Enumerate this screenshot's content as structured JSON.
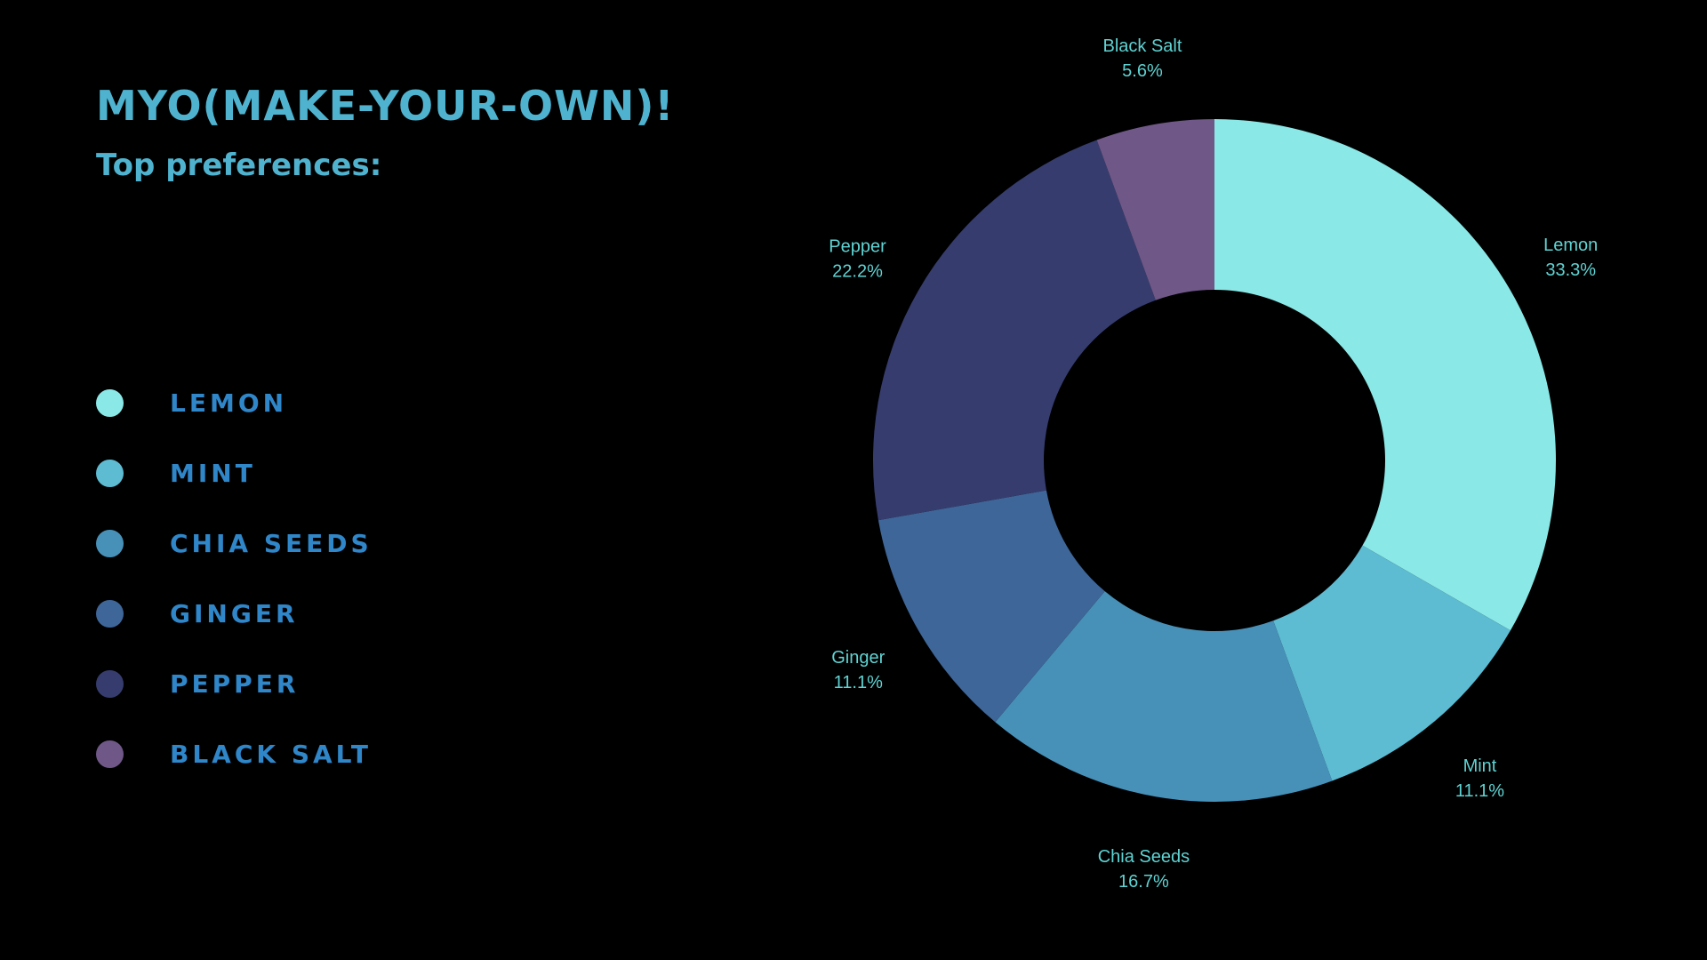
{
  "title": "MYO(MAKE-YOUR-OWN)!",
  "subtitle": "Top preferences:",
  "chart_data": {
    "type": "pie",
    "donut": true,
    "title": "MYO(MAKE-YOUR-OWN)!",
    "subtitle": "Top preferences:",
    "legend_position": "left",
    "categories": [
      "Lemon",
      "Mint",
      "Chia Seeds",
      "Ginger",
      "Pepper",
      "Black Salt"
    ],
    "legend_labels": [
      "LEMON",
      "MINT",
      "CHIA SEEDS",
      "GINGER",
      "PEPPER",
      "BLACK SALT"
    ],
    "values": [
      33.3,
      11.1,
      16.7,
      11.1,
      22.2,
      5.6
    ],
    "value_labels": [
      "33.3%",
      "11.1%",
      "16.7%",
      "11.1%",
      "22.2%",
      "5.6%"
    ],
    "colors": [
      "#8ae8e6",
      "#5dbbd2",
      "#4791b8",
      "#3e6698",
      "#363d6e",
      "#6f5787"
    ]
  }
}
